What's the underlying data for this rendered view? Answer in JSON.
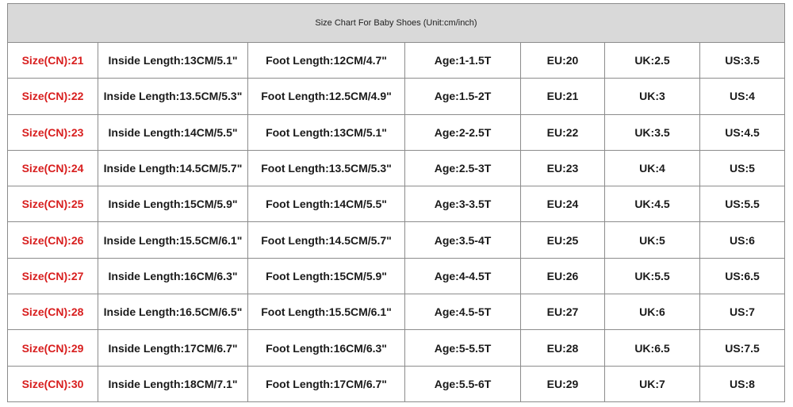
{
  "title": "Size Chart For Baby Shoes (Unit:cm/inch)",
  "colors": {
    "header_bg": "#d9d9d9",
    "size_cn_text": "#d81e1e",
    "body_text": "#1a1a1a",
    "border": "#8c8c8c"
  },
  "rows": [
    {
      "size_cn": "Size(CN):21",
      "inside_length": "Inside Length:13CM/5.1\"",
      "foot_length": "Foot Length:12CM/4.7\"",
      "age": "Age:1-1.5T",
      "eu": "EU:20",
      "uk": "UK:2.5",
      "us": "US:3.5"
    },
    {
      "size_cn": "Size(CN):22",
      "inside_length": "Inside Length:13.5CM/5.3\"",
      "foot_length": "Foot Length:12.5CM/4.9\"",
      "age": "Age:1.5-2T",
      "eu": "EU:21",
      "uk": "UK:3",
      "us": "US:4"
    },
    {
      "size_cn": "Size(CN):23",
      "inside_length": "Inside Length:14CM/5.5\"",
      "foot_length": "Foot Length:13CM/5.1\"",
      "age": "Age:2-2.5T",
      "eu": "EU:22",
      "uk": "UK:3.5",
      "us": "US:4.5"
    },
    {
      "size_cn": "Size(CN):24",
      "inside_length": "Inside Length:14.5CM/5.7\"",
      "foot_length": "Foot Length:13.5CM/5.3\"",
      "age": "Age:2.5-3T",
      "eu": "EU:23",
      "uk": "UK:4",
      "us": "US:5"
    },
    {
      "size_cn": "Size(CN):25",
      "inside_length": "Inside Length:15CM/5.9\"",
      "foot_length": "Foot Length:14CM/5.5\"",
      "age": "Age:3-3.5T",
      "eu": "EU:24",
      "uk": "UK:4.5",
      "us": "US:5.5"
    },
    {
      "size_cn": "Size(CN):26",
      "inside_length": "Inside Length:15.5CM/6.1\"",
      "foot_length": "Foot Length:14.5CM/5.7\"",
      "age": "Age:3.5-4T",
      "eu": "EU:25",
      "uk": "UK:5",
      "us": "US:6"
    },
    {
      "size_cn": "Size(CN):27",
      "inside_length": "Inside Length:16CM/6.3\"",
      "foot_length": "Foot Length:15CM/5.9\"",
      "age": "Age:4-4.5T",
      "eu": "EU:26",
      "uk": "UK:5.5",
      "us": "US:6.5"
    },
    {
      "size_cn": "Size(CN):28",
      "inside_length": "Inside Length:16.5CM/6.5\"",
      "foot_length": "Foot Length:15.5CM/6.1\"",
      "age": "Age:4.5-5T",
      "eu": "EU:27",
      "uk": "UK:6",
      "us": "US:7"
    },
    {
      "size_cn": "Size(CN):29",
      "inside_length": "Inside Length:17CM/6.7\"",
      "foot_length": "Foot Length:16CM/6.3\"",
      "age": "Age:5-5.5T",
      "eu": "EU:28",
      "uk": "UK:6.5",
      "us": "US:7.5"
    },
    {
      "size_cn": "Size(CN):30",
      "inside_length": "Inside Length:18CM/7.1\"",
      "foot_length": "Foot Length:17CM/6.7\"",
      "age": "Age:5.5-6T",
      "eu": "EU:29",
      "uk": "UK:7",
      "us": "US:8"
    }
  ]
}
